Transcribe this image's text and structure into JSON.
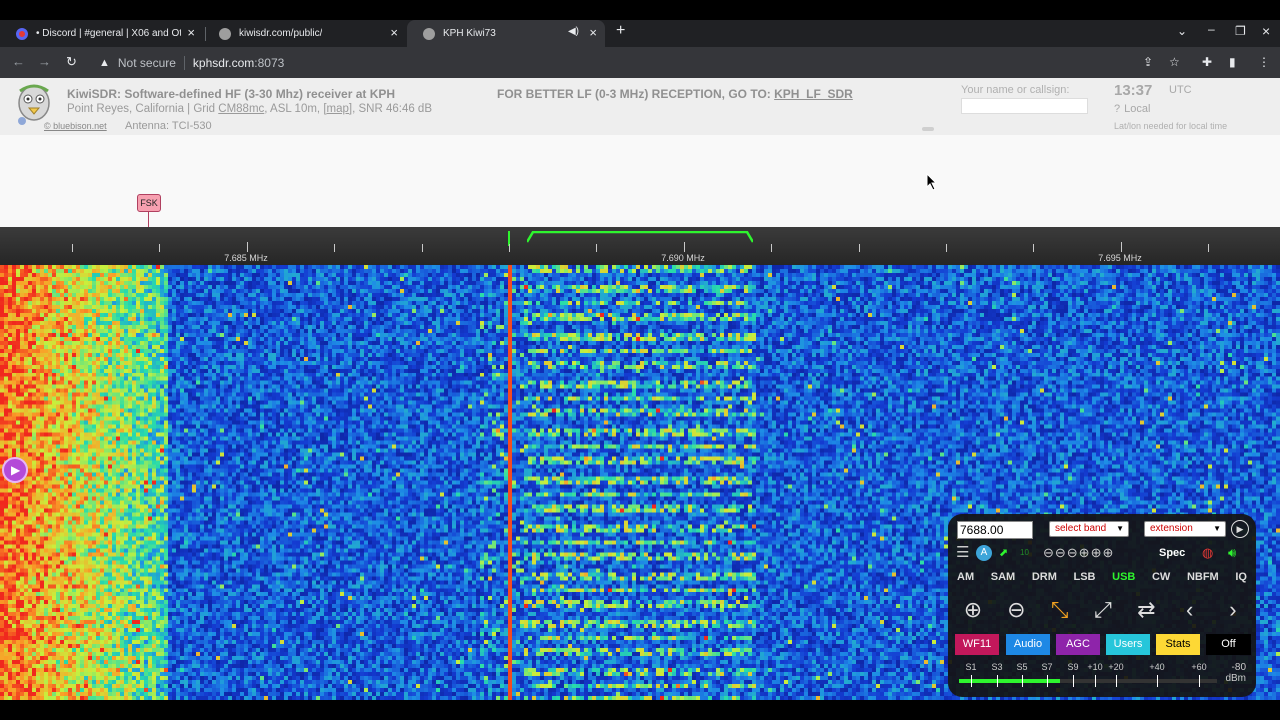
{
  "browser": {
    "tabs": [
      {
        "title": "• Discord | #general | X06 and Ot",
        "favicon": "discord-icon"
      },
      {
        "title": "kiwisdr.com/public/",
        "favicon": "kiwi-icon"
      },
      {
        "title": "KPH Kiwi73",
        "favicon": "kiwi-icon",
        "active": true,
        "muted_icon": "speaker-icon"
      }
    ],
    "security": "Not secure",
    "url_host": "kphsdr.com",
    "url_port": ":8073"
  },
  "header": {
    "logo_credit": "© bluebison.net",
    "title": "KiwiSDR: Software-defined HF (3-30 Mhz) receiver at KPH",
    "location": "Point Reyes, California | Grid ",
    "grid": "CM88mc",
    "asl": ", ASL 10m, ",
    "map_link": "[map]",
    "snr": ", SNR 46:46 dB",
    "antenna": "Antenna: TCI-530",
    "lf_notice": "FOR BETTER LF (0-3 MHz) RECEPTION, GO TO: ",
    "lf_link": "KPH_LF_SDR",
    "callsign_label": "Your name or callsign:",
    "time": "13:37",
    "time_zone": "UTC",
    "local_label": "Local",
    "latlon_note": "Lat/lon needed for local time"
  },
  "spectrum": {
    "marker_label": "FSK",
    "freq_labels": [
      "7.685 MHz",
      "7.690 MHz",
      "7.695 MHz"
    ]
  },
  "panel": {
    "frequency": "7688.00",
    "band_select": "select band",
    "extension_select": "extension",
    "modes": [
      "AM",
      "SAM",
      "DRM",
      "LSB",
      "USB",
      "CW",
      "NBFM",
      "IQ"
    ],
    "selected_mode": "USB",
    "buttons": [
      {
        "label": "WF11",
        "bg": "#c2185b",
        "fg": "#ffffff"
      },
      {
        "label": "Audio",
        "bg": "#1e88e5",
        "fg": "#ffffff"
      },
      {
        "label": "AGC",
        "bg": "#8e24aa",
        "fg": "#ffffff"
      },
      {
        "label": "Users",
        "bg": "#26c6da",
        "fg": "#ffffff"
      },
      {
        "label": "Stats",
        "bg": "#fdd835",
        "fg": "#000000"
      },
      {
        "label": "Off",
        "bg": "#000000",
        "fg": "#ffffff"
      }
    ],
    "smeter_labels": [
      "S1",
      "S3",
      "S5",
      "S7",
      "S9",
      "+10",
      "+20",
      "+40",
      "+60",
      "-80"
    ],
    "smeter_level": 0.39,
    "dbm_label": "dBm"
  },
  "colors": {
    "accent_green": "#2ef52e",
    "waterfall_base": "#0f2aa8"
  }
}
